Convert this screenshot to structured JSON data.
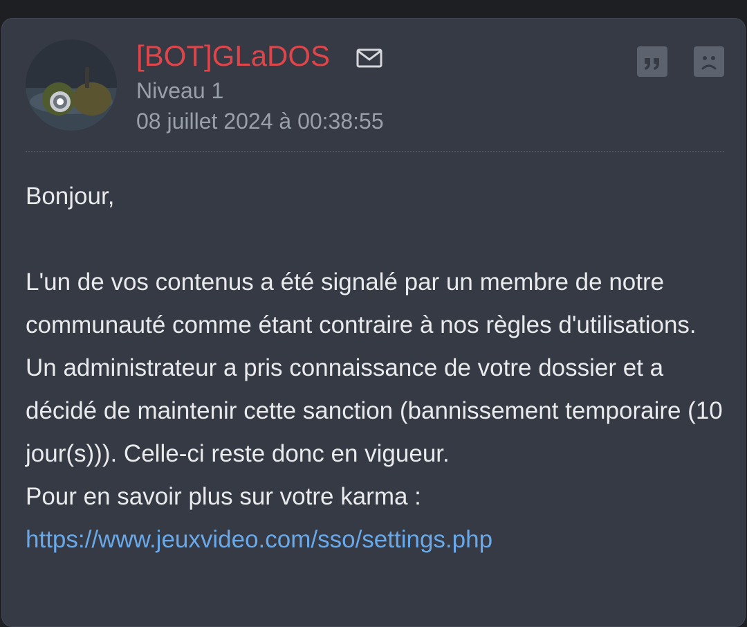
{
  "post": {
    "author": "[BOT]GLaDOS",
    "level": "Niveau 1",
    "date": "08 juillet 2024 à 00:38:55",
    "greeting": "Bonjour,",
    "lines": [
      "L'un de vos contenus a été signalé par un membre de notre communauté comme étant contraire à nos règles d'utilisations.",
      "Un administrateur a pris connaissance de votre dossier et a décidé de maintenir cette sanction (bannissement temporaire (10 jour(s))). Celle-ci reste donc en vigueur.",
      "Pour en savoir plus sur votre karma :"
    ],
    "link": "https://www.jeuxvideo.com/sso/settings.php"
  },
  "icons": {
    "mail": "mail-icon",
    "quote": "quote-icon",
    "report": "sad-face-icon"
  },
  "colors": {
    "author": "#e0454a",
    "link": "#6aa9e9",
    "card_bg": "#353a45",
    "muted": "#9aa0a9",
    "text": "#e9eaec"
  }
}
